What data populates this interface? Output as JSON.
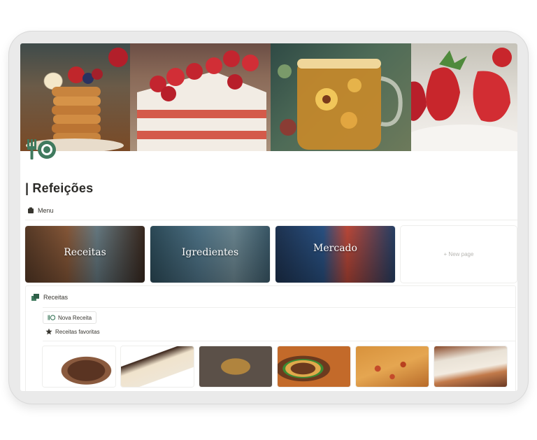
{
  "page": {
    "title": "| Refeições",
    "menu_label": "Menu"
  },
  "gallery": {
    "cards": [
      {
        "label": "Receitas"
      },
      {
        "label": "Igredientes"
      },
      {
        "label": "Mercado"
      }
    ],
    "new_page_label": "+ New page"
  },
  "database": {
    "title": "Receitas",
    "new_button_label": "Nova Receita",
    "favorites_label": "Receitas favoritas"
  },
  "colors": {
    "accent_green": "#3f7a5e",
    "text": "#37352f"
  },
  "icons": {
    "emblem": "fork-plate-icon",
    "menu": "book-icon",
    "database": "stack-icon",
    "favorites": "star-icon"
  }
}
